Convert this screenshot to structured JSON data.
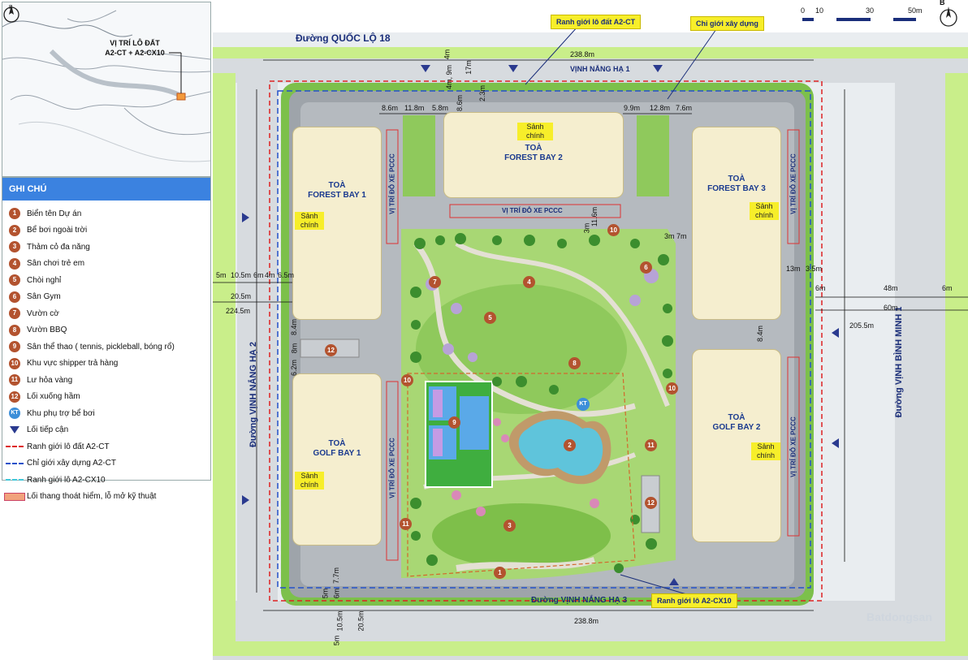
{
  "locator": {
    "title_line1": "VỊ TRÍ LÔ ĐẤT",
    "title_line2": "A2-CT + A2-CX10",
    "compass": "B"
  },
  "legend": {
    "header": "GHI CHÚ",
    "items": [
      {
        "marker": "1",
        "kind": "num",
        "label": "Biển tên Dự án"
      },
      {
        "marker": "2",
        "kind": "num",
        "label": "Bể bơi ngoài trời"
      },
      {
        "marker": "3",
        "kind": "num",
        "label": "Thảm cỏ đa năng"
      },
      {
        "marker": "4",
        "kind": "num",
        "label": "Sân chơi trẻ em"
      },
      {
        "marker": "5",
        "kind": "num",
        "label": "Chòi nghỉ"
      },
      {
        "marker": "6",
        "kind": "num",
        "label": "Sân Gym"
      },
      {
        "marker": "7",
        "kind": "num",
        "label": "Vườn cờ"
      },
      {
        "marker": "8",
        "kind": "num",
        "label": "Vườn BBQ"
      },
      {
        "marker": "9",
        "kind": "num",
        "label": "Sân thể thao ( tennis, pickleball, bóng rổ)"
      },
      {
        "marker": "10",
        "kind": "num",
        "label": "Khu vực shipper trả hàng"
      },
      {
        "marker": "11",
        "kind": "num",
        "label": "Lư hỏa vàng"
      },
      {
        "marker": "12",
        "kind": "num",
        "label": "Lối xuống hầm"
      },
      {
        "marker": "KT",
        "kind": "kt",
        "label": "Khu phụ trợ bể bơi"
      },
      {
        "marker": "",
        "kind": "tri",
        "label": "Lối tiếp cận"
      },
      {
        "marker": "",
        "kind": "ln-red",
        "label": "Ranh giới lô đất A2-CT"
      },
      {
        "marker": "",
        "kind": "ln-blue",
        "label": "Chỉ giới xây dựng A2-CT"
      },
      {
        "marker": "",
        "kind": "ln-cyan",
        "label": "Ranh giới lô A2-CX10"
      },
      {
        "marker": "",
        "kind": "ln-orange",
        "label": "Lối thang thoát hiểm, lỗ mở kỹ thuật"
      }
    ]
  },
  "plan": {
    "road_top": "Đường QUỐC LỘ 18",
    "street_top": "VỊNH NẮNG HẠ 1",
    "road_left": "Đường  VỊNH NẮNG HẠ 2",
    "road_right": "Đường  VỊNH BÌNH MINH 1",
    "road_bottom": "Đường VỊNH NẮNG HẠ 3",
    "callout_plot": "Ranh giới lô đất A2-CT",
    "callout_build": "Chỉ giới xây dựng",
    "callout_cx10": "Ranh giới lô A2-CX10",
    "compass": "B",
    "scale": [
      "0",
      "10",
      "30",
      "50m"
    ],
    "towers": {
      "fb1": {
        "line1": "TOÀ",
        "line2": "FOREST BAY 1",
        "lobby1": "Sảnh",
        "lobby2": "chính"
      },
      "fb2": {
        "line1": "TOÀ",
        "line2": "FOREST BAY 2",
        "lobby": "Sảnh chính"
      },
      "fb3": {
        "line1": "TOÀ",
        "line2": "FOREST BAY 3",
        "lobby1": "Sảnh",
        "lobby2": "chính"
      },
      "gb1": {
        "line1": "TOÀ",
        "line2": "GOLF BAY 1",
        "lobby1": "Sảnh",
        "lobby2": "chính"
      },
      "gb2": {
        "line1": "TOÀ",
        "line2": "GOLF BAY 2",
        "lobby1": "Sảnh",
        "lobby2": "chính"
      }
    },
    "pccc": "VỊ TRÍ ĐỖ XE PCCC",
    "dims": {
      "top_total": "238.8m",
      "bottom_total": "238.8m",
      "left_total": "224.5m",
      "right_total": "205.5m",
      "d_4m": "4m",
      "d_17m": "17m",
      "d_4m9m": "4m, 9m",
      "d_23m": "2.3m",
      "d_86v": "8.6m",
      "d_86": "8.6m",
      "d_118": "11.8m",
      "d_58": "5.8m",
      "d_99": "9.9m",
      "d_128": "12.8m",
      "d_76": "7.6m",
      "d_5m": "5m",
      "d_105": "10.5m",
      "d_6m": "6m",
      "d_4m_b": "4m",
      "d_65": "6.5m",
      "d_205": "20.5m",
      "d_116": "11.6m",
      "d_3m": "3m",
      "d_3m7m": "3m 7m",
      "d_13m": "13m",
      "d_35": "3.5m",
      "d_6m_r": "6m",
      "d_48m": "48m",
      "d_6m_r2": "6m",
      "d_60m": "60m",
      "d_84a": "8.4m",
      "d_8m": "8m",
      "d_62": "6.2m",
      "d_84b": "8.4m",
      "d_77": "7.7m",
      "d_6mb": "6m",
      "d_5mb": "5m",
      "d_105b": "10.5m",
      "d_205b": "20.5m",
      "d_5mbb": "5m"
    },
    "pins": [
      "1",
      "2",
      "3",
      "3",
      "4",
      "5",
      "6",
      "7",
      "8",
      "9",
      "10",
      "10",
      "10",
      "11",
      "11",
      "12",
      "12"
    ],
    "kt": "KT",
    "watermark": "Batdongsan"
  }
}
